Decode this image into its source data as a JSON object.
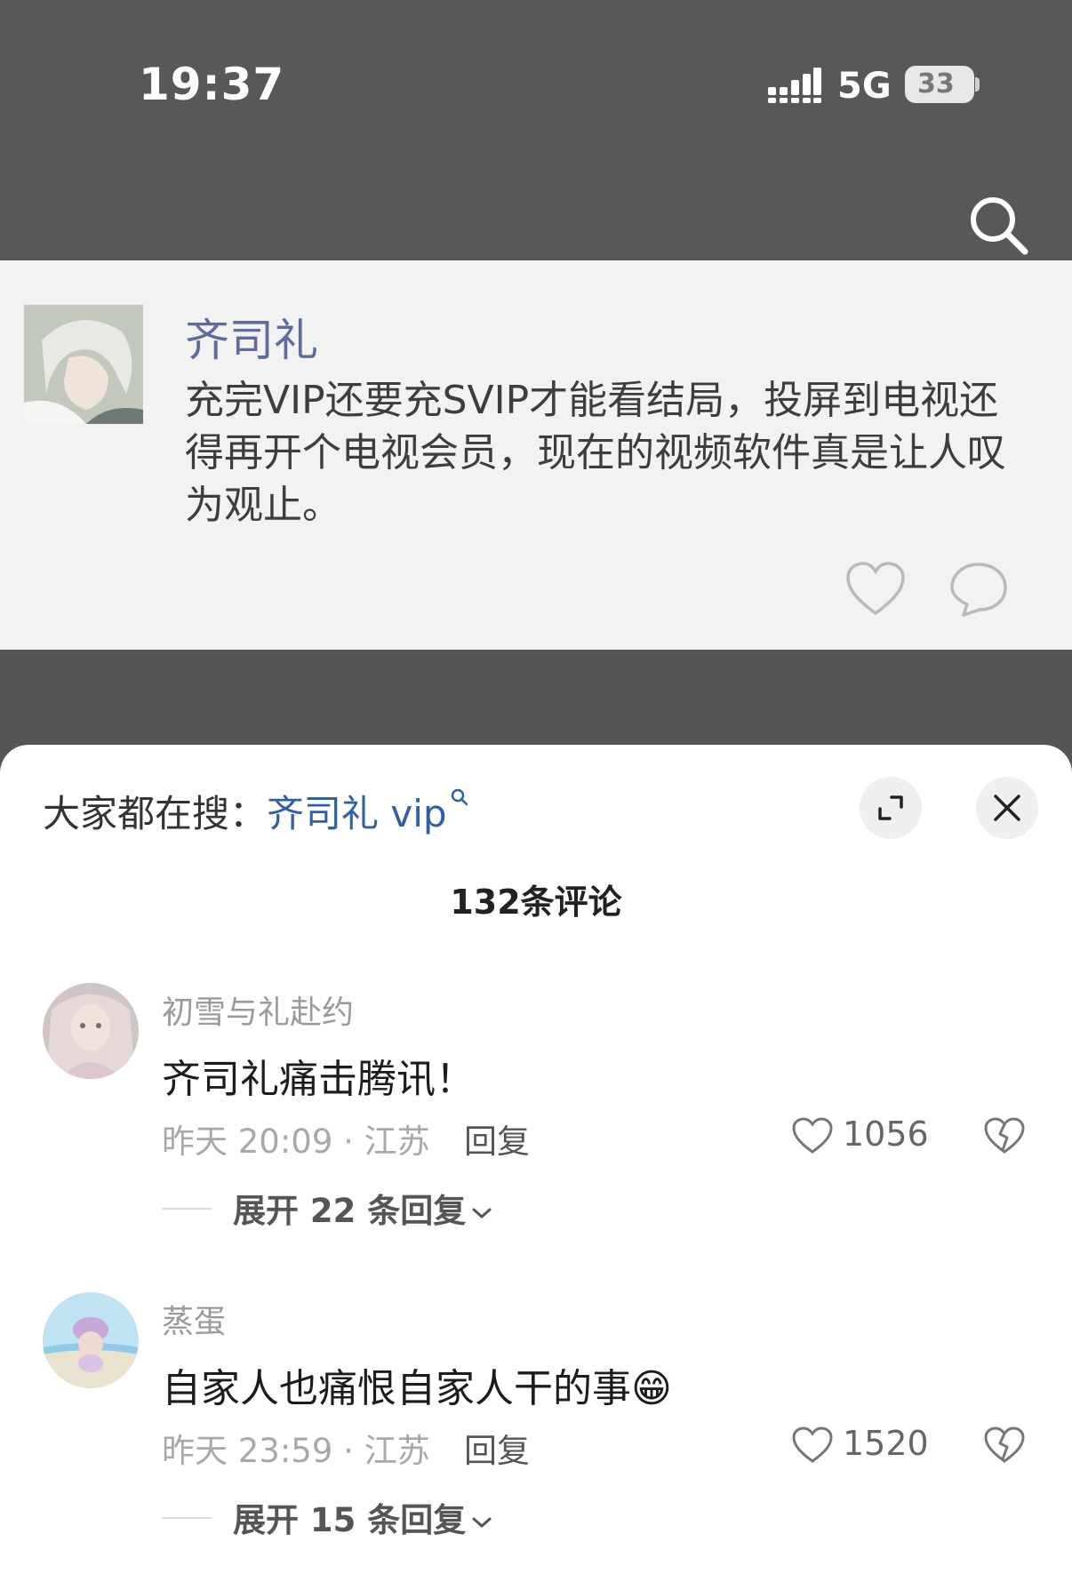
{
  "status_bar": {
    "time": "19:37",
    "network": "5G",
    "battery": "33"
  },
  "post": {
    "author": "齐司礼",
    "text": "充完VIP还要充SVIP才能看结局，投屏到电视还得再开个电视会员，现在的视频软件真是让人叹为观止。",
    "icons": [
      "heart-icon",
      "comment-bubble-icon"
    ]
  },
  "sheet": {
    "trend_prefix": "大家都在搜：",
    "trend_query": "齐司礼 vip",
    "comment_count": "132条评论"
  },
  "comments": [
    {
      "username": "初雪与礼赴约",
      "text": "齐司礼痛击腾讯！",
      "meta": "昨天 20:09 · 江苏",
      "reply_label": "回复",
      "likes": "1056",
      "expand_label": "展开 22 条回复"
    },
    {
      "username": "蒸蛋",
      "text": "自家人也痛恨自家人干的事",
      "emoji": "😁",
      "meta": "昨天 23:59 · 江苏",
      "reply_label": "回复",
      "likes": "1520",
      "expand_label": "展开 15 条回复"
    }
  ],
  "colors": {
    "accent_name": "#5d6c9a",
    "link": "#2f5fa5",
    "dark_bg": "#585858"
  }
}
